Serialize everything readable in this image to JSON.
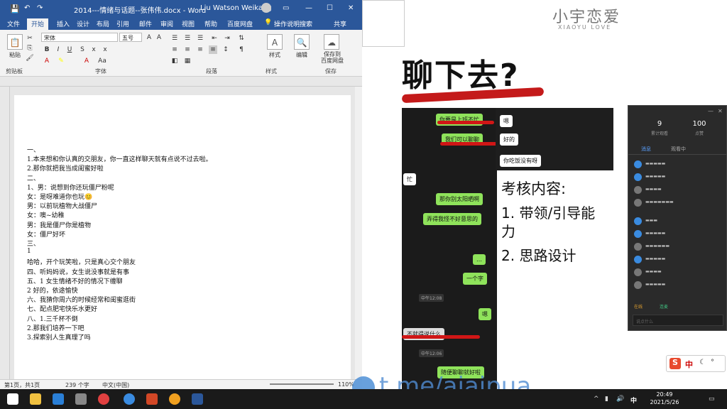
{
  "word": {
    "title": "2014---情绪与话题--张伟伟.docx - Word",
    "user": "Liu Watson Weikang",
    "tabs": [
      "文件",
      "开始",
      "插入",
      "设计",
      "布局",
      "引用",
      "邮件",
      "审阅",
      "视图",
      "帮助",
      "百度网盘",
      "操作说明搜索",
      "共享"
    ],
    "active_tab": "开始",
    "font_name": "宋体",
    "font_size": "五号",
    "groups": [
      "剪贴板",
      "字体",
      "段落",
      "样式",
      "保存"
    ],
    "paste_label": "粘贴",
    "style_label": "样式",
    "edit_label": "编辑",
    "save_cloud_label": "保存到\n百度网盘",
    "doc_lines": [
      "一、",
      "1.本来想和你认真的交朋友，你一直这样聊天就有点说不过去啦。",
      "2.那你就把我当成闺蜜好啦",
      "二、",
      "1、男：说想到你还玩僵尸粉呢",
      "   女：是呀难道你也玩😊",
      "   男：以前玩植物大战僵尸",
      "   女：噢~幼稚",
      "   男：我是僵尸你是植物",
      "   女：僵尸好坏",
      "三、",
      "1",
      "  哈哈，开个玩笑啦，只是真心交个朋友",
      "四、听妈妈说，女生说没事就是有事",
      "五、1 女生情绪不好的情况下缠聊",
      "    2 好的，依途愉快",
      "六、我猜你周六的时候经常和闺蜜逛街",
      "七、配点肥宅快乐水更好",
      "八、1.三千杯不倒",
      "    2.那我们培养一下吧",
      "    3.探索别人生真理了吗"
    ],
    "status": {
      "page": "第1页，共1页",
      "words": "239 个字",
      "lang": "中文(中国)",
      "zoom": "110%"
    }
  },
  "slide": {
    "logo": "小宇恋爱",
    "logo_sub": "XIAOYU LOVE",
    "title": "聊下去?",
    "chat": {
      "green": [
        "你要是上班不忙",
        "我们可以聊聊",
        "那你别太阳晒啊",
        "弄得我怪不好意思的",
        "…",
        "一个字",
        "嗯",
        "随便聊聊就好啦"
      ],
      "white": [
        "嗯",
        "好的",
        "你吃饭没有呀",
        "忙"
      ],
      "times": [
        "中午12:08",
        "中午12:06"
      ],
      "snippet": "不就得说什么"
    },
    "kaohe_title": "考核内容:",
    "kaohe_items": [
      "1.  带领/引导能",
      "     力",
      "2.  思路设计"
    ]
  },
  "panel": {
    "stats": [
      {
        "num": "9",
        "label": "累计观看"
      },
      {
        "num": "100",
        "label": "点赞"
      }
    ],
    "tabs": [
      "消息",
      "观看中"
    ],
    "footer": [
      "在线",
      "连麦"
    ],
    "input_placeholder": "说点什么"
  },
  "watermark": "t.me/aiaipua",
  "ime": {
    "label": "中"
  },
  "taskbar": {
    "time": "20:49",
    "date": "2021/5/26"
  }
}
